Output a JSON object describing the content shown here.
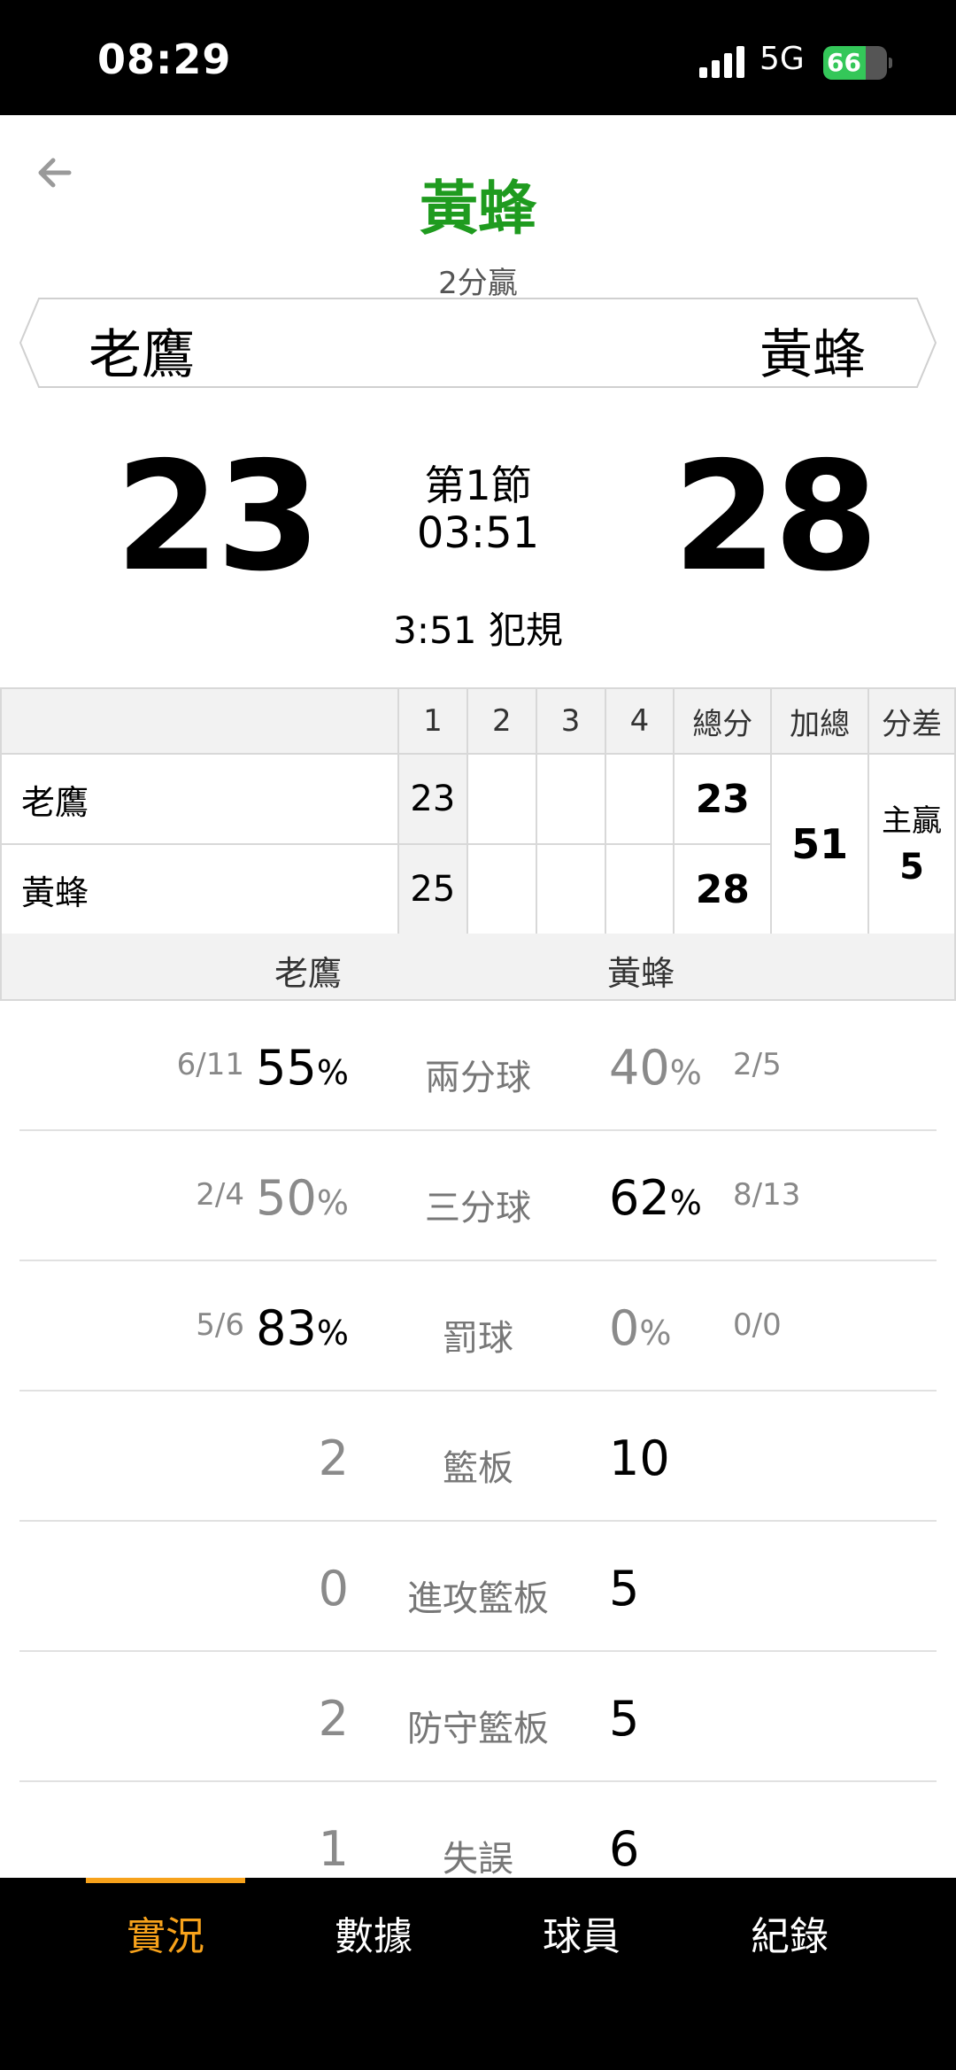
{
  "status": {
    "time": "08:29",
    "network": "5G",
    "battery": "66",
    "battery_level": 0.66
  },
  "header": {
    "title": "黃蜂",
    "subtitle": "2分贏"
  },
  "teams": {
    "left": "老鷹",
    "right": "黃蜂"
  },
  "score": {
    "left": "23",
    "right": "28",
    "period": "第1節",
    "clock": "03:51",
    "event": "3:51 犯規"
  },
  "quarter_table": {
    "headers": [
      "1",
      "2",
      "3",
      "4",
      "總分",
      "加總",
      "分差"
    ],
    "rows": [
      {
        "team": "老鷹",
        "q": [
          "23",
          "",
          "",
          ""
        ],
        "total": "23"
      },
      {
        "team": "黃蜂",
        "q": [
          "25",
          "",
          "",
          ""
        ],
        "total": "28"
      }
    ],
    "sum": "51",
    "diff_label": "主贏",
    "diff_value": "5"
  },
  "stat_header": {
    "left": "老鷹",
    "right": "黃蜂"
  },
  "stats": [
    {
      "label": "兩分球",
      "left_frac": "6/11",
      "left": "55",
      "right": "40",
      "right_frac": "2/5",
      "unit": "%"
    },
    {
      "label": "三分球",
      "left_frac": "2/4",
      "left": "50",
      "right": "62",
      "right_frac": "8/13",
      "unit": "%"
    },
    {
      "label": "罰球",
      "left_frac": "5/6",
      "left": "83",
      "right": "0",
      "right_frac": "0/0",
      "unit": "%"
    },
    {
      "label": "籃板",
      "left": "2",
      "right": "10"
    },
    {
      "label": "進攻籃板",
      "left": "0",
      "right": "5"
    },
    {
      "label": "防守籃板",
      "left": "2",
      "right": "5"
    },
    {
      "label": "失誤",
      "left": "1",
      "right": "6"
    }
  ],
  "tabs": [
    "實況",
    "數據",
    "球員",
    "紀錄"
  ],
  "colors": {
    "title": "#1f9b1f",
    "active_tab": "#f7a21b",
    "battery": "#34c759"
  },
  "icons": {
    "back": "arrow-left-icon",
    "signal": "signal-icon",
    "battery": "battery-charging-icon"
  }
}
